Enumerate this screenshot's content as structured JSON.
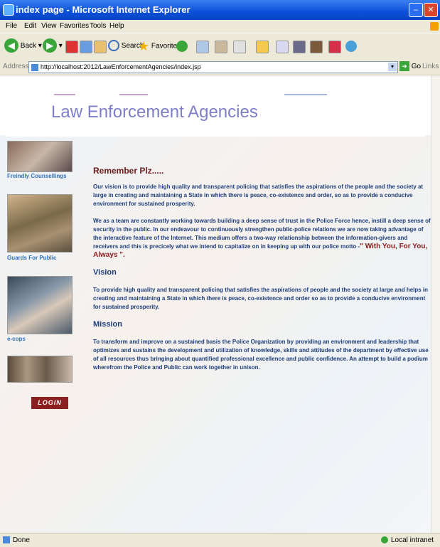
{
  "window": {
    "title": "index page - Microsoft Internet Explorer"
  },
  "menu": [
    "File",
    "Edit",
    "View",
    "Favorites",
    "Tools",
    "Help"
  ],
  "toolbar": {
    "back": "Back",
    "search": "Search",
    "favorites": "Favorites",
    "go": "Go",
    "links": "Links"
  },
  "address": {
    "label": "Address",
    "url": "http://localhost:2012/LawEnforcementAgencies/index.jsp"
  },
  "banner": {
    "title": "Law Enforcement Agencies"
  },
  "sidebar": {
    "items": [
      {
        "label": "Freindly Counsellings"
      },
      {
        "label": "Guards For Public"
      },
      {
        "label": "e-cops"
      }
    ],
    "login": "LOGIN"
  },
  "main": {
    "heading": "Remember Plz.....",
    "p1": "Our vision is to provide high quality and transparent policing that satisfies the aspirations of the people and the society at large in creating and maintaining a State in which there is peace, co-existence and order, so as to provide a conducive environment for sustained prosperity.",
    "p2": "We as a team are constantly working towards building a deep sense of trust in the Police Force hence, instill a deep sense of security in the public. In our endeavour to continuously strengthen public-police relations we are now taking advantage of the interactive feature of the Internet. This medium offers a two-way relationship between the information-givers and receivers and this is precicely what we intend to capitalize on in keeping up with our police motto -",
    "motto": "\" With You, For You, Always \".",
    "vision_heading": "Vision",
    "vision_text": "To provide high quality and transparent policing that satisfies the aspirations of people and the society at large and helps in creating and maintaining a State in which there is peace, co-existence and order so as to provide a conducive environment for sustained prosperity.",
    "mission_heading": "Mission",
    "mission_text": "To transform and improve on a sustained basis the Police Organization by providing an environment and leadership that optimizes and sustains the development and utilization of knowledge, skills and attitudes of the department by effective use of all resources thus bringing about quantified professional excellence and public confidence. An attempt to build a podium wherefrom the Police and Public can work together in unison."
  },
  "status": {
    "left": "Done",
    "right": "Local intranet"
  },
  "colors": {
    "titlebar": "#0b4fd8",
    "accent": "#2f71b9",
    "brand": "#7d7fc8",
    "login": "#8c1f1f"
  }
}
